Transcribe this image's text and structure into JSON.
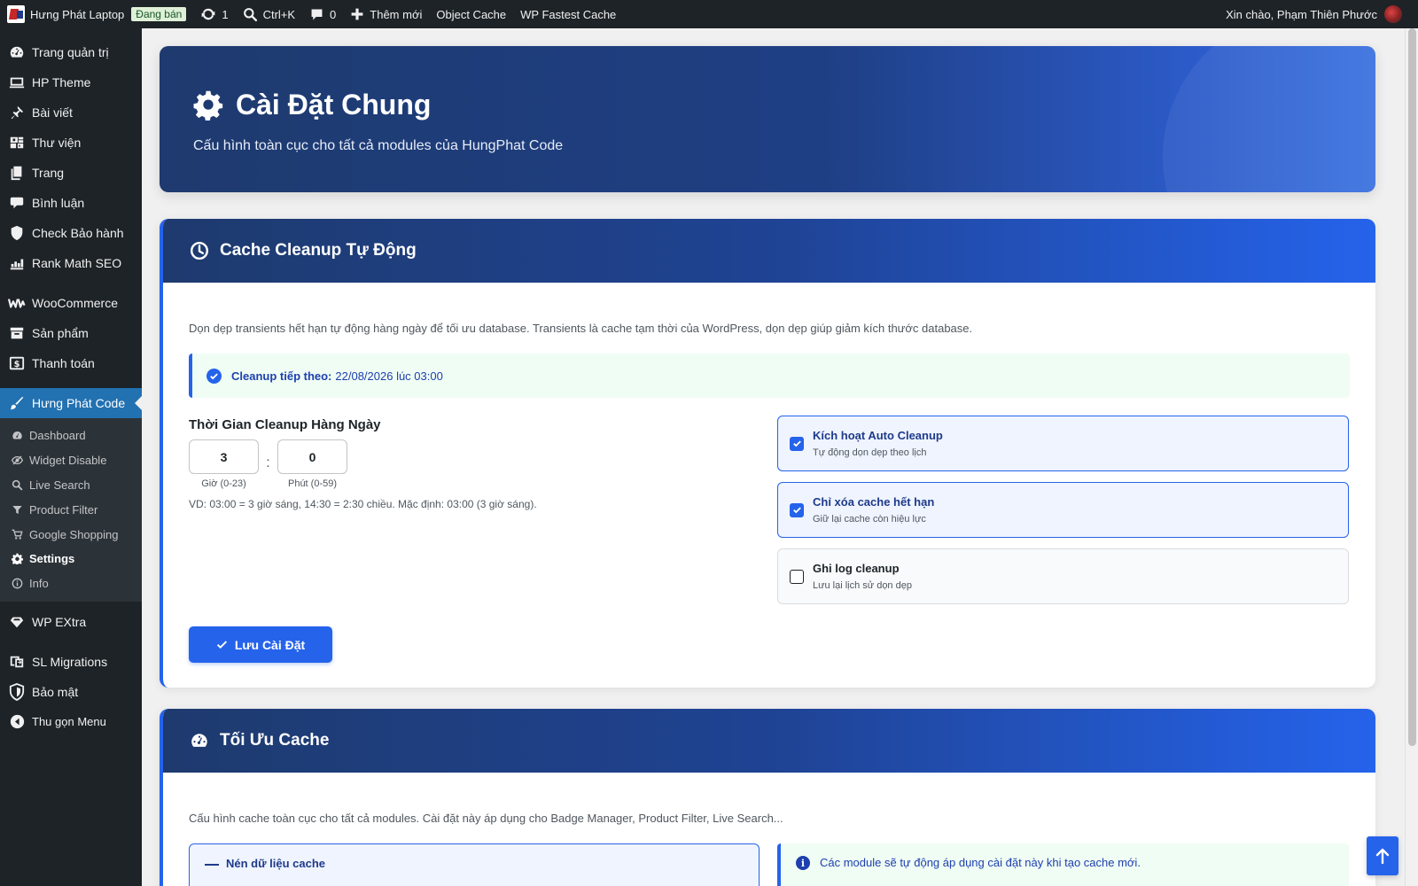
{
  "adminbar": {
    "site_name": "Hưng Phát Laptop",
    "status_badge": "Đang bán",
    "updates_count": "1",
    "search_shortcut": "Ctrl+K",
    "comments_count": "0",
    "add_new": "Thêm mới",
    "object_cache": "Object Cache",
    "fastest_cache": "WP Fastest Cache",
    "greeting": "Xin chào, Phạm Thiên Phước"
  },
  "sidebar": {
    "items": [
      {
        "label": "Trang quản trị",
        "icon": "dashboard-icon"
      },
      {
        "label": "HP Theme",
        "icon": "monitor-icon"
      },
      {
        "label": "Bài viết",
        "icon": "pin-icon"
      },
      {
        "label": "Thư viện",
        "icon": "media-icon"
      },
      {
        "label": "Trang",
        "icon": "pages-icon"
      },
      {
        "label": "Bình luận",
        "icon": "comment-icon"
      },
      {
        "label": "Check Bảo hành",
        "icon": "shield-icon"
      },
      {
        "label": "Rank Math SEO",
        "icon": "chart-icon"
      },
      {
        "label": "WooCommerce",
        "icon": "woo-icon"
      },
      {
        "label": "Sản phẩm",
        "icon": "archive-icon"
      },
      {
        "label": "Thanh toán",
        "icon": "money-icon"
      },
      {
        "label": "Hưng Phát Code",
        "icon": "brush-icon"
      },
      {
        "label": "WP EXtra",
        "icon": "diamond-icon"
      },
      {
        "label": "SL Migrations",
        "icon": "migrate-icon"
      },
      {
        "label": "Bảo mật",
        "icon": "security-icon"
      },
      {
        "label": "Thu gọn Menu",
        "icon": "collapse-icon"
      }
    ],
    "submenu": [
      {
        "label": "Dashboard",
        "icon": "dashboard-icon"
      },
      {
        "label": "Widget Disable",
        "icon": "eye-slash-icon"
      },
      {
        "label": "Live Search",
        "icon": "search-icon"
      },
      {
        "label": "Product Filter",
        "icon": "filter-icon"
      },
      {
        "label": "Google Shopping",
        "icon": "cart-icon"
      },
      {
        "label": "Settings",
        "icon": "gear-icon"
      },
      {
        "label": "Info",
        "icon": "info-icon"
      }
    ]
  },
  "hero": {
    "title": "Cài Đặt Chung",
    "subtitle": "Cấu hình toàn cục cho tất cả modules của HungPhat Code"
  },
  "cleanup": {
    "title": "Cache Cleanup Tự Động",
    "description": "Dọn dẹp transients hết hạn tự động hàng ngày để tối ưu database. Transients là cache tạm thời của WordPress, dọn dẹp giúp giảm kích thước database.",
    "next_label": "Cleanup tiếp theo:",
    "next_value": "22/08/2026 lúc 03:00",
    "time_title": "Thời Gian Cleanup Hàng Ngày",
    "hour_value": "3",
    "hour_label": "Giờ (0-23)",
    "time_sep": ":",
    "minute_value": "0",
    "minute_label": "Phút (0-59)",
    "hint": "VD: 03:00 = 3 giờ sáng, 14:30 = 2:30 chiều. Mặc định: 03:00 (3 giờ sáng).",
    "options": [
      {
        "title": "Kích hoạt Auto Cleanup",
        "desc": "Tự động dọn dẹp theo lịch",
        "checked": true
      },
      {
        "title": "Chỉ xóa cache hết hạn",
        "desc": "Giữ lại cache còn hiệu lực",
        "checked": true
      },
      {
        "title": "Ghi log cleanup",
        "desc": "Lưu lại lịch sử dọn dẹp",
        "checked": false
      }
    ],
    "save_label": "Lưu Cài Đặt"
  },
  "optimize": {
    "title": "Tối Ưu Cache",
    "description": "Cấu hình cache toàn cục cho tất cả modules. Cài đặt này áp dụng cho Badge Manager, Product Filter, Live Search...",
    "compress_label": "Nén dữ liệu cache",
    "info_text": "Các module sẽ tự động áp dụng cài đặt này khi tạo cache mới."
  },
  "colors": {
    "accent": "#2563eb",
    "header_dark": "#1e3a6e",
    "admin_bg": "#1d2327"
  }
}
